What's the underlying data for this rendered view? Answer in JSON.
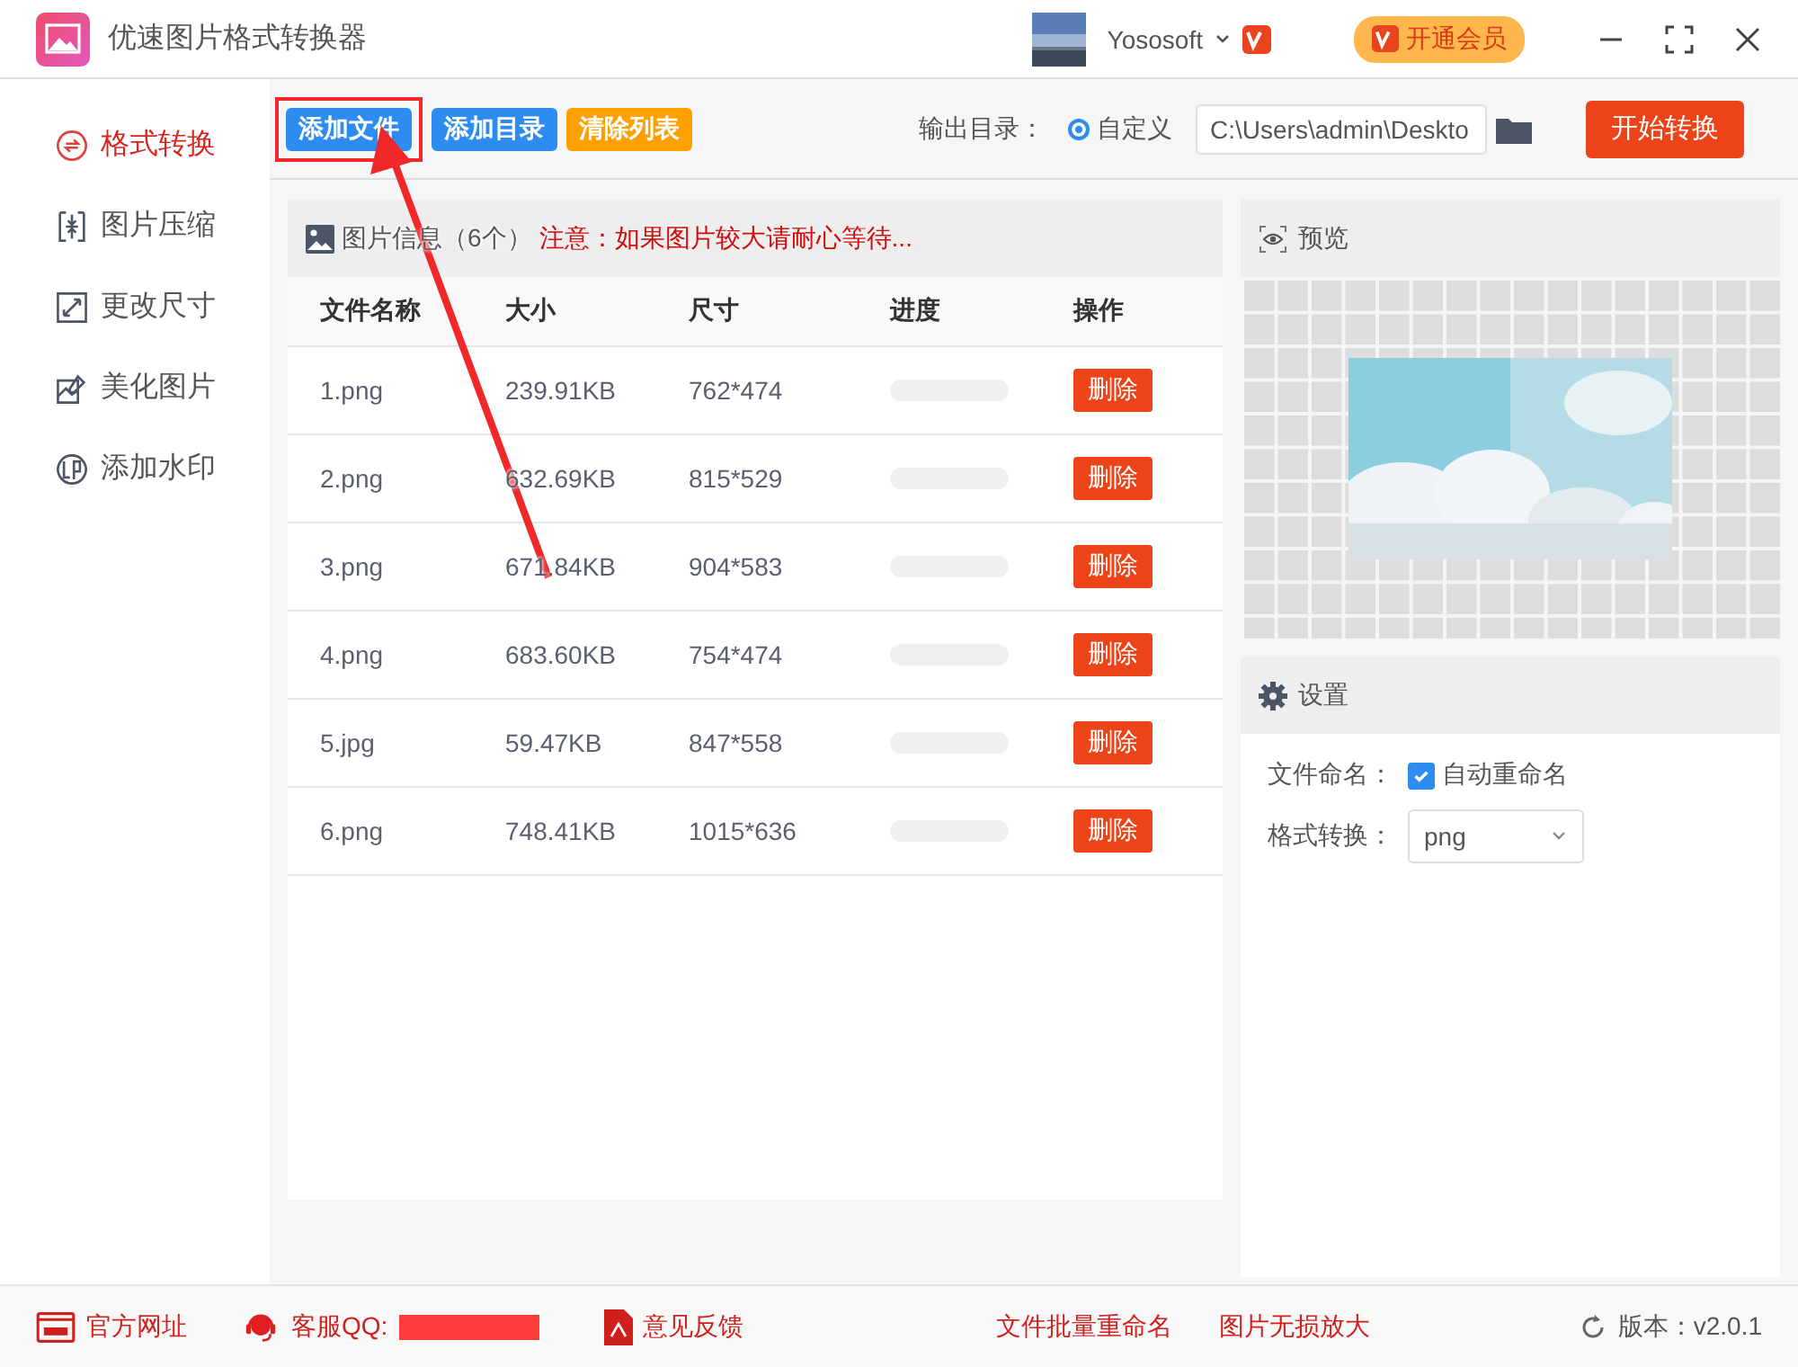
{
  "window": {
    "title": "优速图片格式转换器"
  },
  "account": {
    "name": "Yososoft",
    "vip_button": "开通会员"
  },
  "toolbar": {
    "buttons": [
      {
        "label": "添加文件",
        "kind": "primary",
        "highlighted": true
      },
      {
        "label": "添加目录",
        "kind": "primary",
        "highlighted": false
      },
      {
        "label": "清除列表",
        "kind": "warning",
        "highlighted": false
      }
    ],
    "output_label": "输出目录：",
    "option": {
      "label": "自定义",
      "selected": true
    },
    "path": "C:\\Users\\admin\\Deskto",
    "start_button": "开始转换"
  },
  "sidebar": {
    "items": [
      {
        "label": "格式转换",
        "selected": true
      },
      {
        "label": "图片压缩",
        "selected": false
      },
      {
        "label": "更改尺寸",
        "selected": false
      },
      {
        "label": "美化图片",
        "selected": false
      },
      {
        "label": "添加水印",
        "selected": false
      }
    ]
  },
  "file_panel": {
    "title": "图片信息（6个）",
    "notice": "注意：如果图片较大请耐心等待...",
    "columns": [
      "文件名称",
      "大小",
      "尺寸",
      "进度",
      "操作"
    ],
    "rows": [
      {
        "name": "1.png",
        "size": "239.91KB",
        "dims": "762*474",
        "level": 0,
        "action": "删除"
      },
      {
        "name": "2.png",
        "size": "632.69KB",
        "dims": "815*529",
        "level": 0,
        "action": "删除"
      },
      {
        "name": "3.png",
        "size": "671.84KB",
        "dims": "904*583",
        "level": 0,
        "action": "删除"
      },
      {
        "name": "4.png",
        "size": "683.60KB",
        "dims": "754*474",
        "level": 0,
        "action": "删除"
      },
      {
        "name": "5.jpg",
        "size": "59.47KB",
        "dims": "847*558",
        "level": 0,
        "action": "删除"
      },
      {
        "name": "6.png",
        "size": "748.41KB",
        "dims": "1015*636",
        "level": 0,
        "action": "删除"
      }
    ]
  },
  "preview": {
    "title": "预览"
  },
  "settings": {
    "title": "设置",
    "naming_label": "文件命名：",
    "auto_rename": {
      "label": "自动重命名",
      "checked": true
    },
    "format_label": "格式转换：",
    "format_value": "png"
  },
  "status_bar": {
    "links": [
      "官方网址",
      "客服QQ:"
    ],
    "feedback": "意见反馈",
    "tools": [
      "文件批量重命名",
      "图片无损放大"
    ],
    "version": "版本：v2.0.1"
  }
}
